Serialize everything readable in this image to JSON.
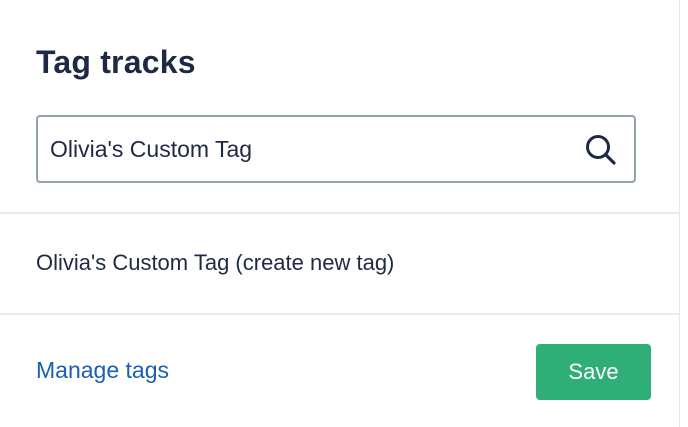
{
  "dialog": {
    "title": "Tag tracks"
  },
  "search": {
    "value": "Olivia's Custom Tag",
    "icon": "search-icon"
  },
  "suggestions": [
    {
      "label": "Olivia's Custom Tag (create new tag)"
    }
  ],
  "footer": {
    "manage_label": "Manage tags",
    "save_label": "Save"
  },
  "colors": {
    "title": "#1e2a44",
    "link": "#1a5fb4",
    "save_button": "#2fae78",
    "input_border": "#8fa3ab"
  }
}
